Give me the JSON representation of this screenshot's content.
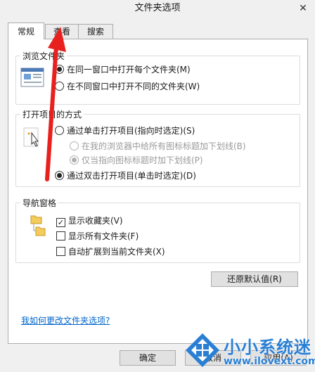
{
  "window": {
    "title": "文件夹选项",
    "close_glyph": "✕"
  },
  "tabs": [
    {
      "label": "常规",
      "active": true
    },
    {
      "label": "查看",
      "active": false
    },
    {
      "label": "搜索",
      "active": false
    }
  ],
  "browse": {
    "title": "浏览文件夹",
    "options": [
      {
        "label": "在同一窗口中打开每个文件夹(M)",
        "checked": true
      },
      {
        "label": "在不同窗口中打开不同的文件夹(W)",
        "checked": false
      }
    ]
  },
  "click": {
    "title": "打开项目的方式",
    "options": [
      {
        "label": "通过单击打开项目(指向时选定)(S)",
        "checked": false
      },
      {
        "label": "在我的浏览器中给所有图标标题加下划线(B)",
        "checked": false,
        "disabled": true
      },
      {
        "label": "仅当指向图标标题时加下划线(P)",
        "checked": true,
        "disabled": true
      },
      {
        "label": "通过双击打开项目(单击时选定)(D)",
        "checked": true
      }
    ]
  },
  "nav": {
    "title": "导航窗格",
    "options": [
      {
        "label": "显示收藏夹(V)",
        "checked": true
      },
      {
        "label": "显示所有文件夹(F)",
        "checked": false
      },
      {
        "label": "自动扩展到当前文件夹(X)",
        "checked": false
      }
    ]
  },
  "restore_button": "还原默认值(R)",
  "help_link": "我如何更改文件夹选项?",
  "footer": {
    "ok": "确定",
    "cancel": "取消",
    "apply": "应用(A)"
  },
  "watermark": {
    "brand": "小小系统迷",
    "url": "www.ilovext.com"
  },
  "colors": {
    "arrow": "#e8211f",
    "watermark_blue": "#2a7fd4",
    "link": "#0066cc"
  }
}
